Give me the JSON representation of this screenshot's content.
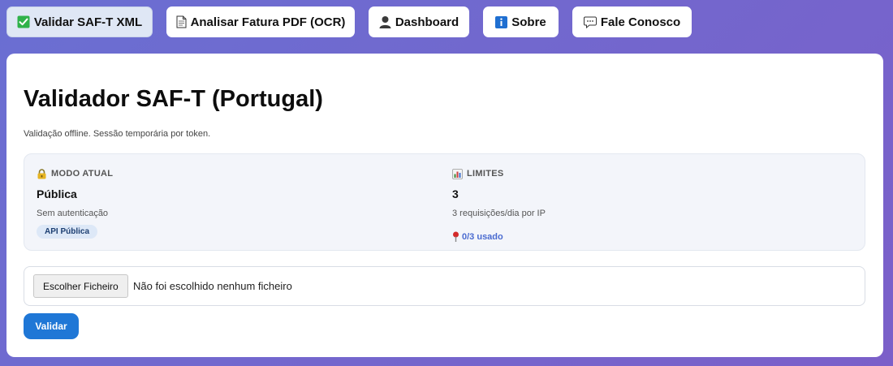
{
  "nav": {
    "items": [
      {
        "label": "Validar SAF-T XML",
        "icon": "check-icon",
        "active": true
      },
      {
        "label": "Analisar Fatura PDF (OCR)",
        "icon": "document-icon",
        "active": false
      },
      {
        "label": "Dashboard",
        "icon": "user-icon",
        "active": false
      },
      {
        "label": "Sobre",
        "icon": "info-icon",
        "active": false
      },
      {
        "label": "Fale Conosco",
        "icon": "chat-icon",
        "active": false
      }
    ]
  },
  "main": {
    "title": "Validador SAF-T (Portugal)",
    "subtitle": "Validação offline. Sessão temporária por token.",
    "mode": {
      "heading": "MODO ATUAL",
      "icon": "lock-icon",
      "value": "Pública",
      "note": "Sem autenticação",
      "badge": "API Pública"
    },
    "limits": {
      "heading": "LIMITES",
      "icon": "bar-chart-icon",
      "value": "3",
      "note": "3 requisições/dia por IP",
      "usage": "0/3 usado",
      "usage_icon": "pin-icon"
    },
    "file": {
      "button_label": "Escolher Ficheiro",
      "status": "Não foi escolhido nenhum ficheiro"
    },
    "validate_label": "Validar"
  },
  "colors": {
    "accent": "#1f77d6",
    "usage": "#4a6bd0",
    "check": "#2fb24a"
  }
}
